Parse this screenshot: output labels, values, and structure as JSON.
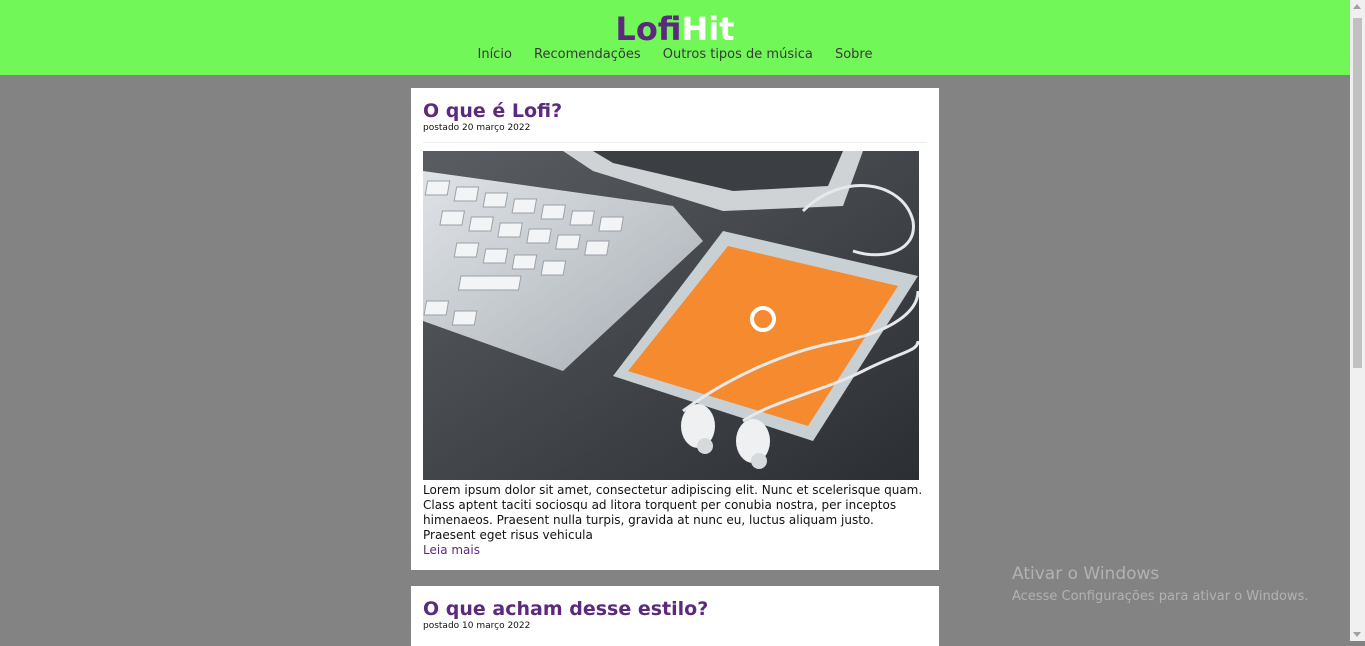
{
  "header": {
    "logo_part1": "Lofi",
    "logo_part2": "Hit",
    "colors": {
      "bar": "#72f758",
      "logo_dark": "#5b2a7d",
      "logo_light": "#ffffff"
    },
    "nav": [
      "Início",
      "Recomendações",
      "Outros tipos de música",
      "Sobre"
    ]
  },
  "posts": [
    {
      "title": "O que é Lofi?",
      "date": "postado 20 março 2022",
      "image": "photo of keyboard, smartphone with orange music app and earphones",
      "body": "Lorem ipsum dolor sit amet, consectetur adipiscing elit. Nunc et scelerisque quam. Class aptent taciti sociosqu ad litora torquent per conubia nostra, per inceptos himenaeos. Praesent nulla turpis, gravida at nunc eu, luctus aliquam justo. Praesent eget risus vehicula",
      "more": "Leia mais"
    },
    {
      "title": "O que acham desse estilo?",
      "date": "postado 10 março 2022"
    }
  ],
  "watermark": {
    "line1": "Ativar o Windows",
    "line2": "Acesse Configurações para ativar o Windows."
  }
}
